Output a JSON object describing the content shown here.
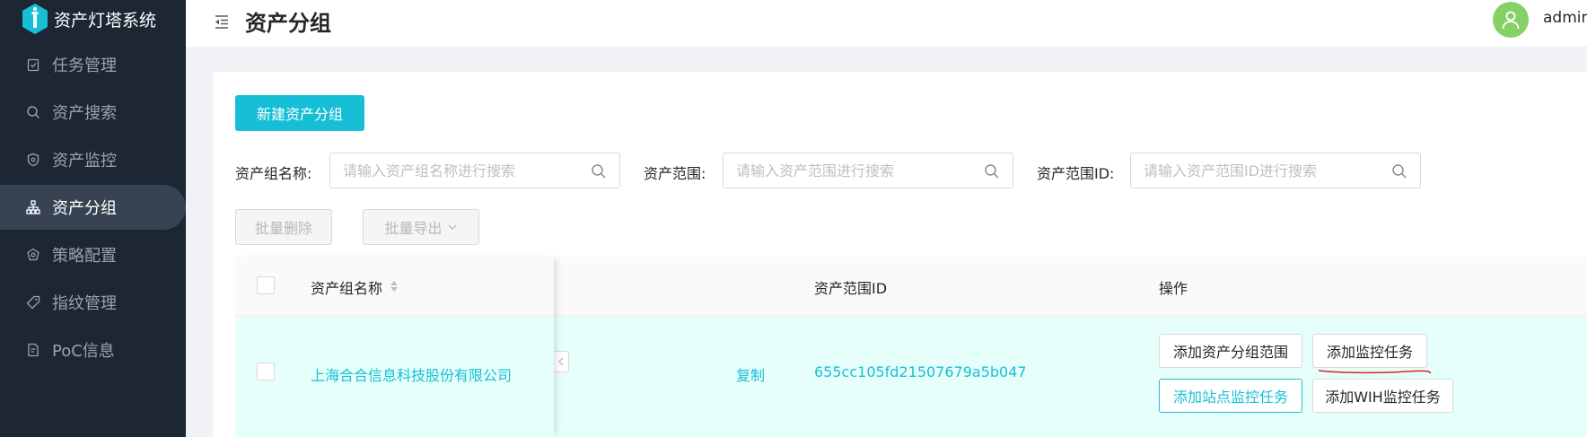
{
  "app": {
    "name": "资产灯塔系统"
  },
  "sidebar": {
    "items": [
      {
        "label": "任务管理",
        "icon": "clipboard-icon",
        "active": false
      },
      {
        "label": "资产搜索",
        "icon": "search-icon",
        "active": false
      },
      {
        "label": "资产监控",
        "icon": "shield-icon",
        "active": false
      },
      {
        "label": "资产分组",
        "icon": "sitemap-icon",
        "active": true
      },
      {
        "label": "策略配置",
        "icon": "policy-icon",
        "active": false
      },
      {
        "label": "指纹管理",
        "icon": "tag-icon",
        "active": false
      },
      {
        "label": "PoC信息",
        "icon": "document-icon",
        "active": false
      }
    ]
  },
  "header": {
    "title": "资产分组",
    "username": "admin"
  },
  "toolbar": {
    "create_label": "新建资产分组",
    "batch_delete_label": "批量删除",
    "batch_export_label": "批量导出"
  },
  "filters": [
    {
      "label": "资产组名称:",
      "placeholder": "请输入资产组名称进行搜索"
    },
    {
      "label": "资产范围:",
      "placeholder": "请输入资产范围进行搜索"
    },
    {
      "label": "资产范围ID:",
      "placeholder": "请输入资产范围ID进行搜索"
    }
  ],
  "table": {
    "columns": {
      "name": "资产组名称",
      "scope_id": "资产范围ID",
      "actions": "操作"
    },
    "rows": [
      {
        "name": "上海合合信息科技股份有限公司",
        "copy_label": "复制",
        "scope_id": "655cc105fd21507679a5b047",
        "actions": [
          "添加资产分组范围",
          "添加监控任务",
          "添加站点监控任务",
          "添加WIH监控任务"
        ]
      }
    ]
  },
  "colors": {
    "sidebar_bg": "#1d2733",
    "primary": "#17bfd6",
    "row_highlight": "#e6fffb",
    "avatar": "#87d068",
    "annotation": "#e02020"
  }
}
